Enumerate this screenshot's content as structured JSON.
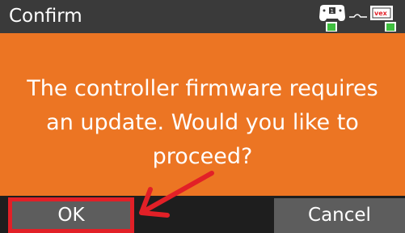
{
  "dialog": {
    "title": "Confirm",
    "message": "The controller firmware requires an update. Would you like to proceed?",
    "ok_label": "OK",
    "cancel_label": "Cancel"
  },
  "status_icons": {
    "controller_icon": "controller-icon",
    "link_icon": "link-icon",
    "brain_icon": "vex-brain-icon",
    "brain_label": "vex"
  },
  "colors": {
    "titlebar": "#3a3a3a",
    "content": "#ec7523",
    "buttonbar": "#1e1e1e",
    "button": "#5d5d5d",
    "highlight": "#e22027",
    "battery": "#3fbf3f"
  }
}
